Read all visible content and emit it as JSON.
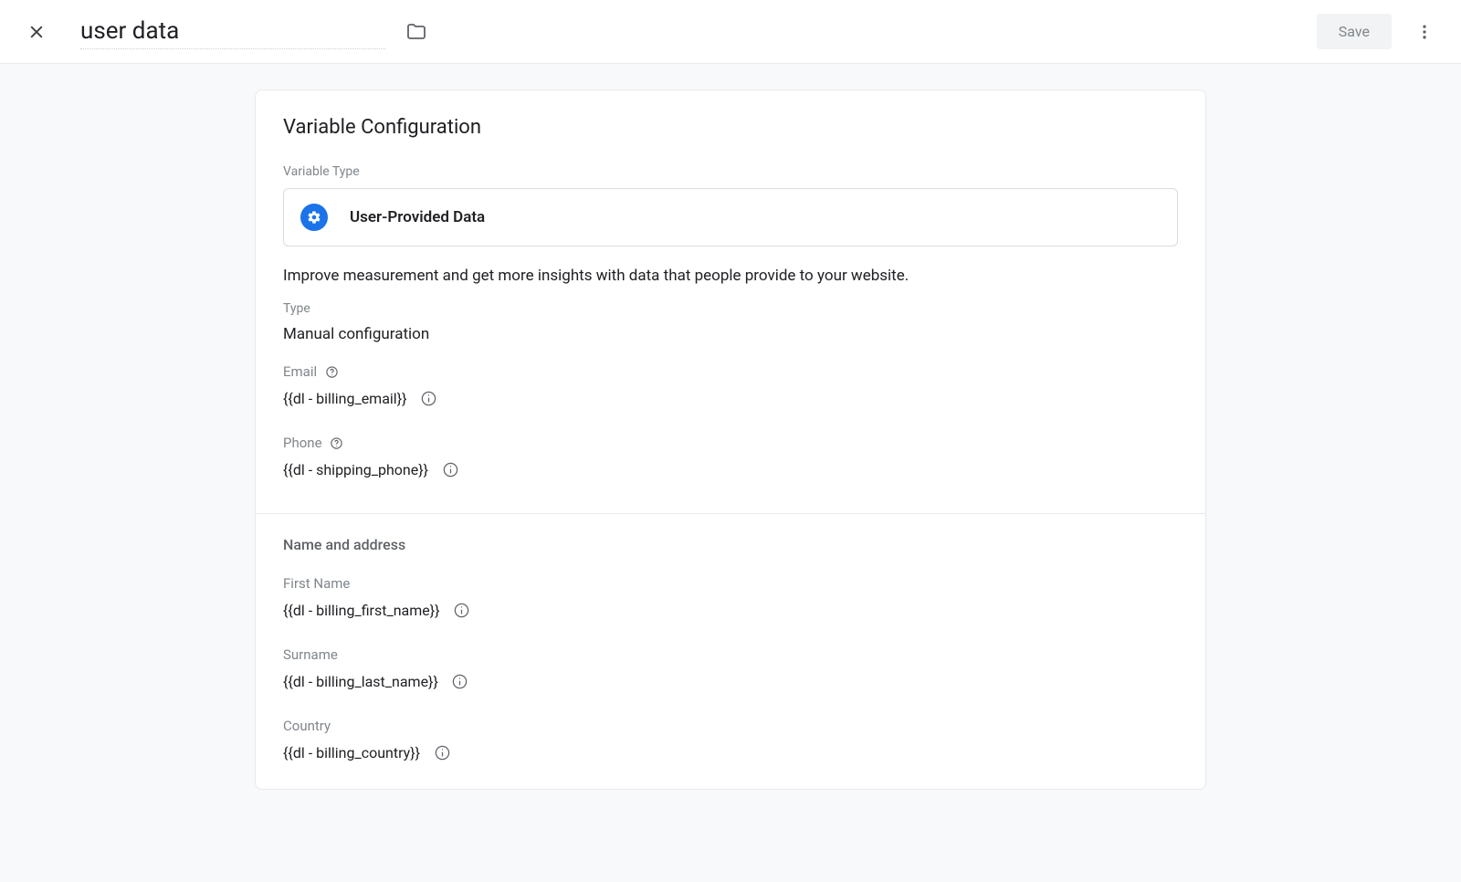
{
  "header": {
    "title": "user data",
    "save_label": "Save"
  },
  "card": {
    "title": "Variable Configuration",
    "variable_type_label": "Variable Type",
    "variable_type_value": "User-Provided Data",
    "description": "Improve measurement and get more insights with data that people provide to your website.",
    "type_label": "Type",
    "type_value": "Manual configuration",
    "fields": {
      "email": {
        "label": "Email",
        "value": "{{dl - billing_email}}"
      },
      "phone": {
        "label": "Phone",
        "value": "{{dl - shipping_phone}}"
      }
    },
    "name_address": {
      "header": "Name and address",
      "first_name": {
        "label": "First Name",
        "value": "{{dl - billing_first_name}}"
      },
      "surname": {
        "label": "Surname",
        "value": "{{dl - billing_last_name}}"
      },
      "country": {
        "label": "Country",
        "value": "{{dl - billing_country}}"
      }
    }
  }
}
